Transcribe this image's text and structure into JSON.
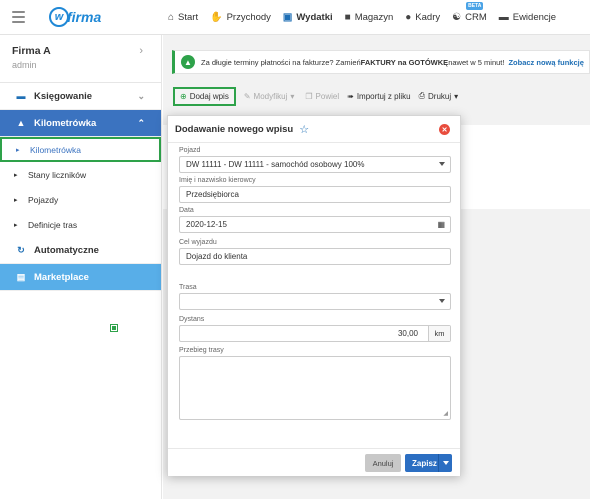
{
  "topbar": {
    "logo_text": "firma",
    "logo_mark": "w",
    "nav": [
      {
        "label": "Start",
        "icon": "home-icon"
      },
      {
        "label": "Przychody",
        "icon": "hand-coins-icon"
      },
      {
        "label": "Wydatki",
        "icon": "wallet-icon",
        "active": true
      },
      {
        "label": "Magazyn",
        "icon": "warehouse-icon"
      },
      {
        "label": "Kadry",
        "icon": "users-icon"
      },
      {
        "label": "CRM",
        "icon": "handshake-icon",
        "badge": "BETA"
      },
      {
        "label": "Ewidencje",
        "icon": "folder-icon"
      }
    ]
  },
  "sidebar": {
    "company_name": "Firma A",
    "user": "admin",
    "items": [
      {
        "label": "Księgowanie"
      },
      {
        "label": "Kilometrówka"
      },
      {
        "label": "Kilometrówka"
      },
      {
        "label": "Stany liczników"
      },
      {
        "label": "Pojazdy"
      },
      {
        "label": "Definicje tras"
      },
      {
        "label": "Automatyczne"
      },
      {
        "label": "Marketplace"
      }
    ]
  },
  "notice": {
    "text": "Za długie terminy płatności na fakturze? Zamień ",
    "bold": "FAKTURY na GOTÓWKĘ",
    "text2": " nawet w 5 minut!",
    "link": "Zobacz nową funkcję"
  },
  "toolbar": {
    "add": "Dodaj wpis",
    "modify": "Modyfikuj",
    "repeat": "Powiel",
    "import": "Importuj z pliku",
    "print": "Drukuj"
  },
  "modal": {
    "title": "Dodawanie nowego wpisu",
    "fields": {
      "vehicle_label": "Pojazd",
      "vehicle_value": "DW 11111 - DW 11111 - samochód osobowy 100%",
      "driver_label": "Imię i nazwisko kierowcy",
      "driver_value": "Przedsiębiorca",
      "date_label": "Data",
      "date_value": "2020-12-15",
      "purpose_label": "Cel wyjazdu",
      "purpose_value": "Dojazd do klienta",
      "route_label": "Trasa",
      "route_value": "",
      "distance_label": "Dystans",
      "distance_value": "30,00",
      "distance_unit": "km",
      "course_label": "Przebieg trasy"
    },
    "cancel": "Anuluj",
    "save": "Zapisz"
  },
  "colors": {
    "accent": "#3b73c0",
    "highlight": "#2ea24a",
    "marketplace": "#58aee8",
    "close": "#e84c3d"
  }
}
